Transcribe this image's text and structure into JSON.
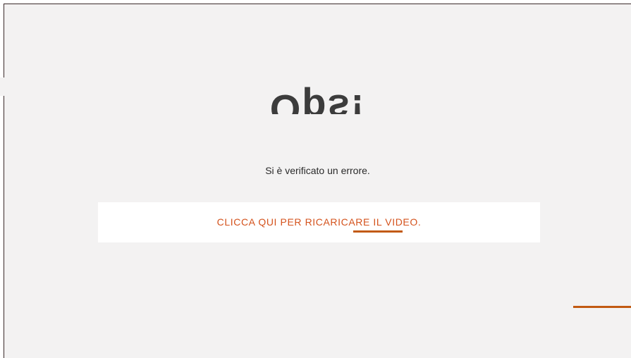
{
  "error": {
    "title": "Ops!",
    "message": "Si è verificato un errore.",
    "reload_link": "CLICCA QUI PER RICARICARE IL VIDEO."
  },
  "colors": {
    "background": "#f3f2f2",
    "panel": "#ffffff",
    "accent": "#c25a12",
    "link": "#d4521c",
    "text": "#2a2a2a"
  }
}
